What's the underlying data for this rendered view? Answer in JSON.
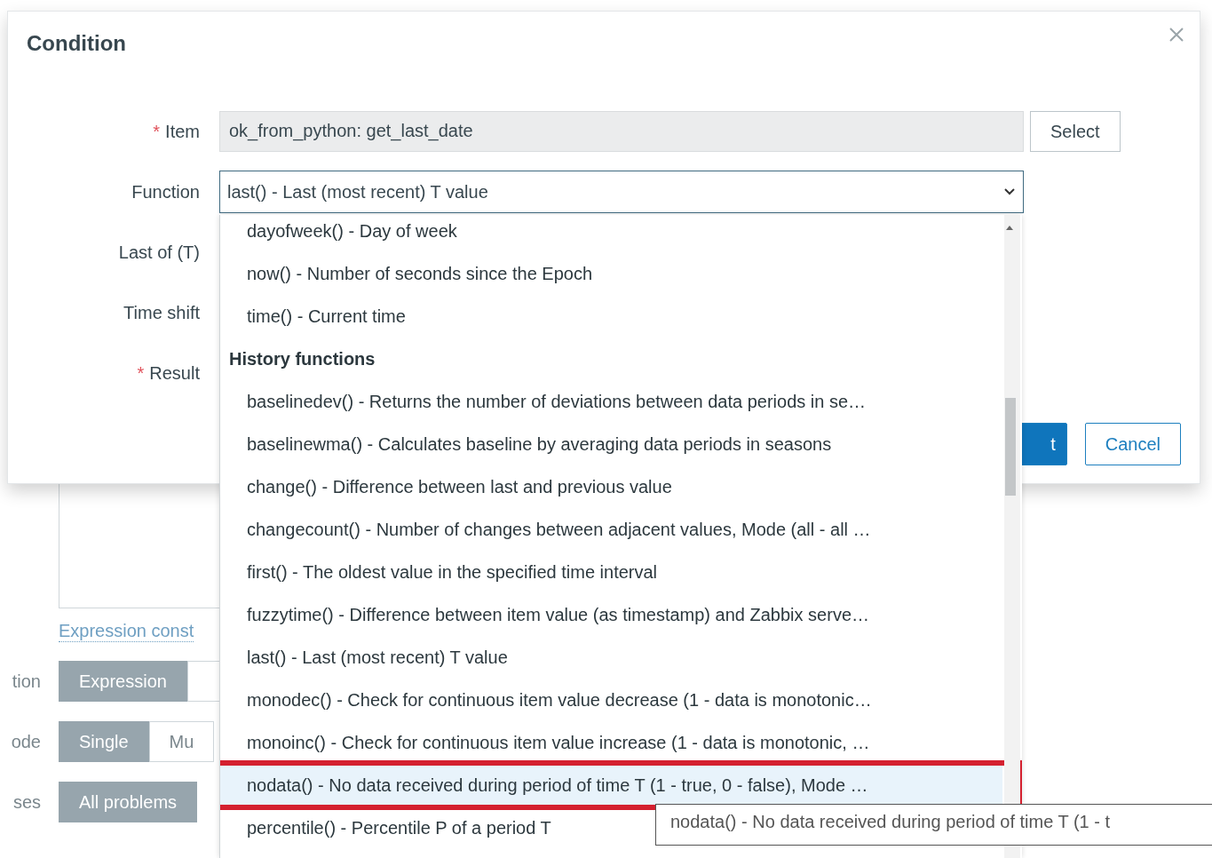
{
  "background": {
    "link": "Expression const",
    "rows": [
      {
        "label": "tion",
        "segments": [
          {
            "label": "Expression",
            "selected": true
          },
          {
            "selected": false
          }
        ]
      },
      {
        "label": "ode",
        "segments": [
          {
            "label": "Single",
            "selected": true
          },
          {
            "label": "Mu",
            "selected": false
          }
        ]
      },
      {
        "label": "ses",
        "segments": [
          {
            "label": "All problems",
            "selected": true
          }
        ]
      }
    ]
  },
  "dialog": {
    "title": "Condition",
    "fields": [
      {
        "label": "Item",
        "marker": "*",
        "kind": "readonly",
        "value": "ok_from_python: get_last_date",
        "button": "Select"
      },
      {
        "label": "Function",
        "kind": "select",
        "value": "last() - Last (most recent) T value"
      },
      {
        "label": "Last of (T)",
        "kind": "empty"
      },
      {
        "label": "Time shift",
        "kind": "empty"
      },
      {
        "label": "Result",
        "marker": "*",
        "kind": "empty"
      }
    ],
    "buttons": [
      {
        "label": "t",
        "kind": "primary"
      },
      {
        "label": "Cancel",
        "kind": "secondary"
      }
    ]
  },
  "dropdown": {
    "items": [
      {
        "kind": "option",
        "label": "dayofweek() - Day of week",
        "selected": false
      },
      {
        "kind": "option",
        "label": "now() - Number of seconds since the Epoch",
        "selected": false
      },
      {
        "kind": "option",
        "label": "time() - Current time",
        "selected": false
      },
      {
        "kind": "group",
        "label": "History functions"
      },
      {
        "kind": "option",
        "label": "baselinedev() - Returns the number of deviations between data periods in se…",
        "selected": false
      },
      {
        "kind": "option",
        "label": "baselinewma() - Calculates baseline by averaging data periods in seasons",
        "selected": false
      },
      {
        "kind": "option",
        "label": "change() - Difference between last and previous value",
        "selected": false
      },
      {
        "kind": "option",
        "label": "changecount() - Number of changes between adjacent values, Mode (all - all …",
        "selected": false
      },
      {
        "kind": "option",
        "label": "first() - The oldest value in the specified time interval",
        "selected": false
      },
      {
        "kind": "option",
        "label": "fuzzytime() - Difference between item value (as timestamp) and Zabbix serve…",
        "selected": false
      },
      {
        "kind": "option",
        "label": "last() - Last (most recent) T value",
        "selected": false
      },
      {
        "kind": "option",
        "label": "monodec() - Check for continuous item value decrease (1 - data is monotonic…",
        "selected": false
      },
      {
        "kind": "option",
        "label": "monoinc() - Check for continuous item value increase (1 - data is monotonic, …",
        "selected": false
      },
      {
        "kind": "option",
        "label": "nodata() - No data received during period of time T (1 - true, 0 - false), Mode …",
        "selected": true
      },
      {
        "kind": "option",
        "label": "percentile() - Percentile P of a period T",
        "selected": false
      }
    ]
  },
  "tooltip": {
    "text": "nodata() - No data received during period of time T (1 - t"
  }
}
